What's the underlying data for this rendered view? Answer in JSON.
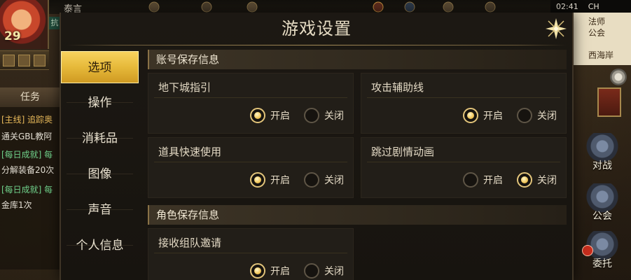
{
  "status_bar": {
    "time": "02:41",
    "carrier": "CH"
  },
  "player": {
    "name": "泰言",
    "level": "29",
    "tag": "抗"
  },
  "quest_panel": {
    "title": "任务",
    "lines": [
      {
        "text": "[主线] 追踪奥",
        "style": "gold"
      },
      {
        "text": "通关GBL教阿",
        "style": "white"
      },
      {
        "text": "[每日成就] 每",
        "style": "green"
      },
      {
        "text": "分解装备20次",
        "style": "white"
      },
      {
        "text": "[每日成就] 每",
        "style": "green"
      },
      {
        "text": "金库1次",
        "style": "white"
      }
    ]
  },
  "right_hud": {
    "sign_lines": [
      "法师",
      "公会",
      "西海岸"
    ],
    "buttons": [
      {
        "label": "对战",
        "icon": "battle-emblem-icon"
      },
      {
        "label": "公会",
        "icon": "guild-emblem-icon"
      },
      {
        "label": "委托",
        "icon": "commission-emblem-icon"
      }
    ]
  },
  "dialog": {
    "title": "游戏设置",
    "close_icon": "close-star-icon",
    "nav": [
      {
        "label": "选项",
        "active": true
      },
      {
        "label": "操作",
        "active": false
      },
      {
        "label": "消耗品",
        "active": false
      },
      {
        "label": "图像",
        "active": false
      },
      {
        "label": "声音",
        "active": false
      },
      {
        "label": "个人信息",
        "active": false
      }
    ],
    "sections": [
      {
        "header": "账号保存信息",
        "settings": [
          {
            "title": "地下城指引",
            "options": [
              "开启",
              "关闭"
            ],
            "selected": "开启"
          },
          {
            "title": "攻击辅助线",
            "options": [
              "开启",
              "关闭"
            ],
            "selected": "开启"
          },
          {
            "title": "道具快速使用",
            "options": [
              "开启",
              "关闭"
            ],
            "selected": "开启"
          },
          {
            "title": "跳过剧情动画",
            "options": [
              "开启",
              "关闭"
            ],
            "selected": "关闭"
          }
        ]
      },
      {
        "header": "角色保存信息",
        "settings": [
          {
            "title": "接收组队邀请",
            "options": [
              "开启",
              "关闭"
            ],
            "selected": "开启"
          }
        ]
      }
    ]
  },
  "colors": {
    "accent_gold": "#e6b93a",
    "panel_bg": "#1c1813",
    "card_bg": "#221e18"
  }
}
